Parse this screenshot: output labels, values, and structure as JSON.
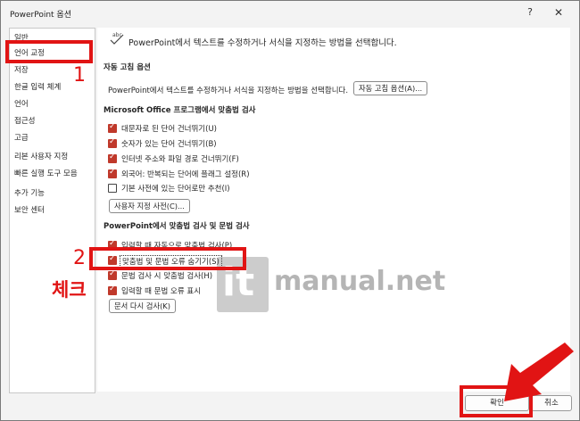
{
  "window": {
    "title": "PowerPoint 옵션",
    "help_label": "?",
    "close_label": "✕"
  },
  "sidebar": {
    "items": [
      {
        "label": "일반"
      },
      {
        "label": "언어 교정"
      },
      {
        "label": "저장"
      },
      {
        "label": "한글 입력 체계"
      },
      {
        "label": "언어"
      },
      {
        "label": "접근성"
      },
      {
        "label": "고급"
      },
      {
        "label": "리본 사용자 지정"
      },
      {
        "label": "빠른 실행 도구 모음"
      },
      {
        "label": "추가 기능"
      },
      {
        "label": "보안 센터"
      }
    ]
  },
  "main": {
    "header_text": "PowerPoint에서 텍스트를 수정하거나 서식을 지정하는 방법을 선택합니다.",
    "autocorrect": {
      "title": "자동 고침 옵션",
      "desc": "PowerPoint에서 텍스트를 수정하거나 서식을 지정하는 방법을 선택합니다.",
      "button": "자동 고침 옵션(A)..."
    },
    "office": {
      "title": "Microsoft Office 프로그램에서 맞춤법 검사",
      "checkboxes": [
        {
          "label": "대문자로 된 단어 건너뛰기(U)",
          "checked": true
        },
        {
          "label": "숫자가 있는 단어 건너뛰기(B)",
          "checked": true
        },
        {
          "label": "인터넷 주소와 파일 경로 건너뛰기(F)",
          "checked": true
        },
        {
          "label": "외국어: 반복되는 단어에 플래그 설정(R)",
          "checked": true
        },
        {
          "label": "기본 사전에 있는 단어로만 추천(I)",
          "checked": false
        }
      ],
      "dict_button": "사용자 지정 사전(C)..."
    },
    "ppt": {
      "title": "PowerPoint에서 맞춤법 검사 및 문법 검사",
      "checkboxes": [
        {
          "label": "입력할 때 자동으로 맞춤법 검사(P)",
          "checked": true
        },
        {
          "label": "맞춤법 및 문법 오류 숨기기(S)",
          "checked": true
        },
        {
          "label": "문법 검사 시 맞춤법 검사(H)",
          "checked": true
        },
        {
          "label": "입력할 때 문법 오류 표시",
          "checked": true
        }
      ],
      "recheck_button": "문서 다시 검사(K)"
    }
  },
  "footer": {
    "ok_label": "확인",
    "cancel_label": "취소"
  },
  "annotations": {
    "step1": "1",
    "step2": "2",
    "check_label": "체크",
    "color": "#e11414"
  },
  "watermark": {
    "it": "it",
    "rest": "manual.net"
  },
  "colors": {
    "checkbox": "#c0392b",
    "annotation": "#e11414"
  }
}
